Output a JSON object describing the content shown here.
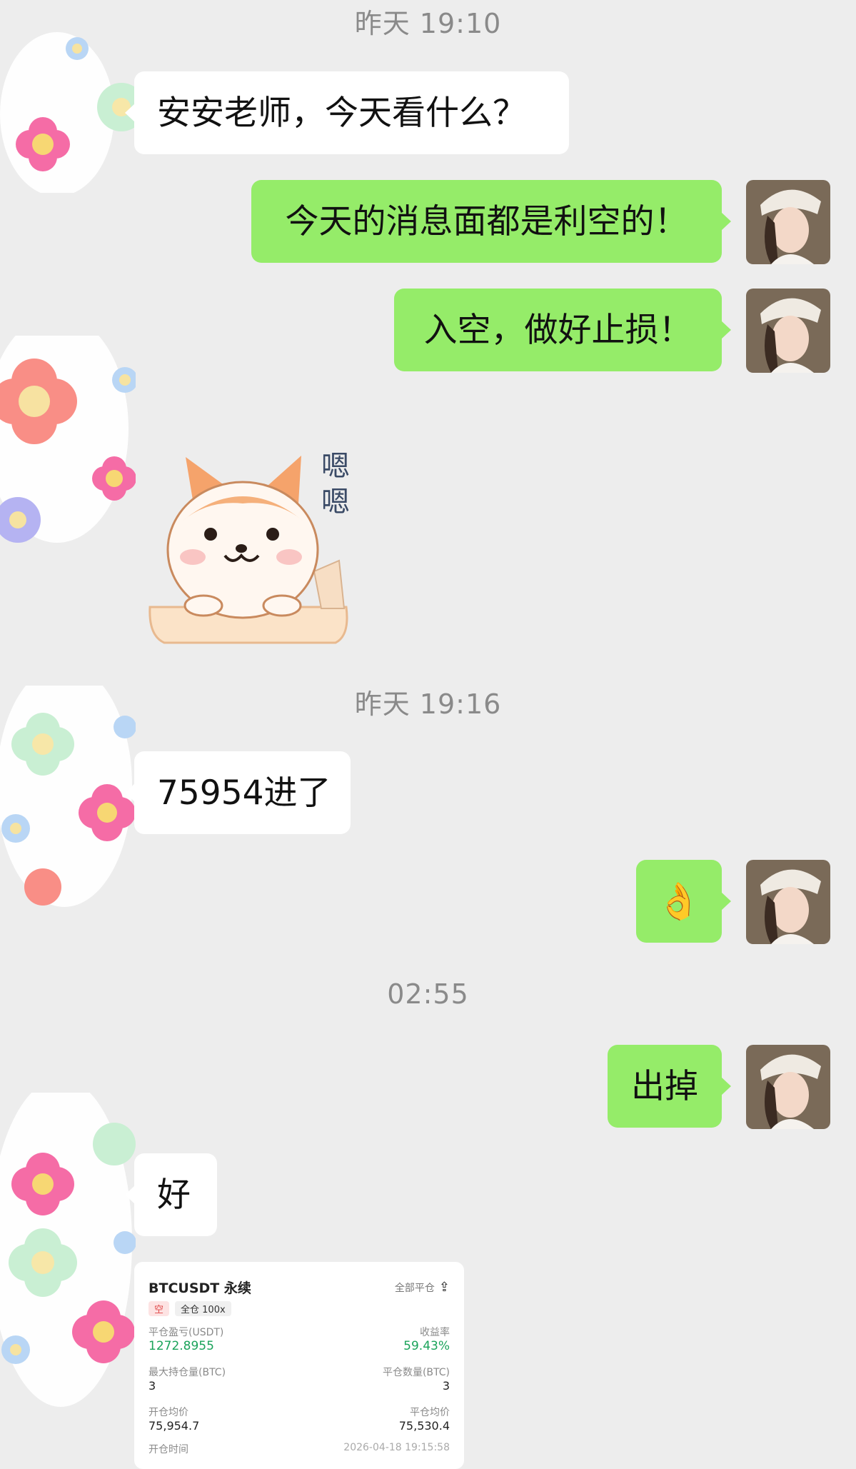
{
  "colors": {
    "background": "#ededed",
    "incoming_bubble": "#ffffff",
    "outgoing_bubble": "#95ec69",
    "timestamp": "#8a8a8a",
    "profit_green": "#1aa35a"
  },
  "messages": {
    "ts1": "昨天 19:10",
    "m1": "安安老师，今天看什么？",
    "m2": "今天的消息面都是利空的！",
    "m3": "入空，做好止损！",
    "sticker_text_1": "嗯",
    "sticker_text_2": "嗯",
    "ts2": "昨天 19:16",
    "m4": "75954进了",
    "m5": "👌",
    "ts3": "02:55",
    "m6": "出掉",
    "m7": "好"
  },
  "icons": {
    "sticker": "shiba-dog-sticker",
    "avatar": "user-avatar-photo",
    "flowers": "flower-avatar",
    "share": "share-icon"
  },
  "card": {
    "title": "BTCUSDT 永续",
    "close_all": "全部平仓",
    "tag_short": "空",
    "tag_margin": "全仓 100x",
    "pnl_label": "平仓盈亏(USDT)",
    "pnl_value": "1272.8955",
    "roi_label": "收益率",
    "roi_value": "59.43%",
    "max_hold_label": "最大持仓量(BTC)",
    "max_hold_value": "3",
    "close_qty_label": "平仓数量(BTC)",
    "close_qty_value": "3",
    "open_avg_label": "开仓均价",
    "open_avg_value": "75,954.7",
    "close_avg_label": "平仓均价",
    "close_avg_value": "75,530.4",
    "open_time_label": "开仓时间",
    "open_time_value": "2026-04-18 19:15:58"
  }
}
